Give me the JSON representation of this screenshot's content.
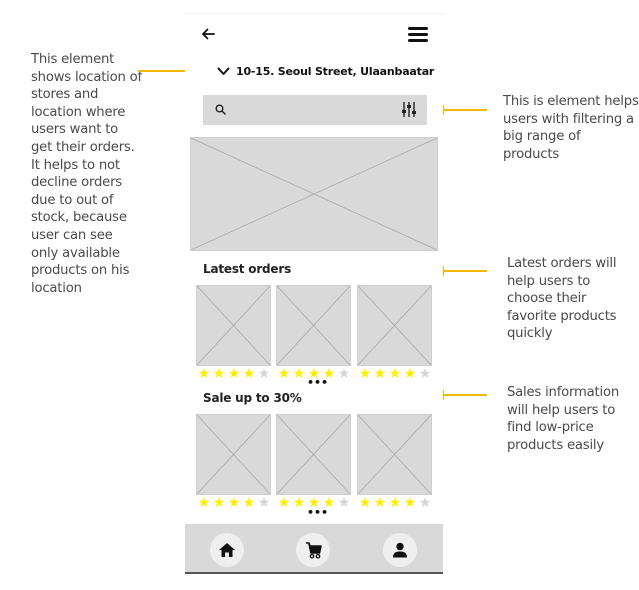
{
  "annotations": {
    "location": "This element shows location of stores and location where users want to get their orders. It helps to not decline orders due to out of stock, because user can see only available products on his location",
    "filter": "This is element helps users with filtering a big range of products",
    "latest": "Latest orders will help users to choose their favorite products quickly",
    "sale": "Sales information will help users to find low-price products easily",
    "arrow_color": "#f5b800"
  },
  "header": {
    "back_icon": "arrow-left-icon",
    "menu_icon": "hamburger-menu-icon"
  },
  "location": {
    "address": "10-15. Seoul Street, Ulaanbaatar",
    "icon": "chevron-down-icon"
  },
  "search": {
    "placeholder": "",
    "icon": "search-icon",
    "filter_icon": "sliders-icon"
  },
  "hero": {
    "image": "image-placeholder"
  },
  "latest_orders": {
    "title": "Latest orders",
    "items": [
      {
        "rating": 4,
        "max": 5
      },
      {
        "rating": 4,
        "max": 5
      },
      {
        "rating": 4,
        "max": 5
      }
    ],
    "more_label": "•••"
  },
  "sale": {
    "title": "Sale up to 30%",
    "items": [
      {
        "rating": 4,
        "max": 5
      },
      {
        "rating": 4,
        "max": 5
      },
      {
        "rating": 4,
        "max": 5
      }
    ],
    "more_label": "•••"
  },
  "bottom_nav": {
    "items": [
      {
        "name": "home",
        "icon": "home-icon"
      },
      {
        "name": "cart",
        "icon": "cart-icon"
      },
      {
        "name": "profile",
        "icon": "user-icon"
      }
    ]
  },
  "colors": {
    "star_on": "#ffee00",
    "star_off": "#d6d6d6",
    "placeholder": "#d9d9d9"
  }
}
